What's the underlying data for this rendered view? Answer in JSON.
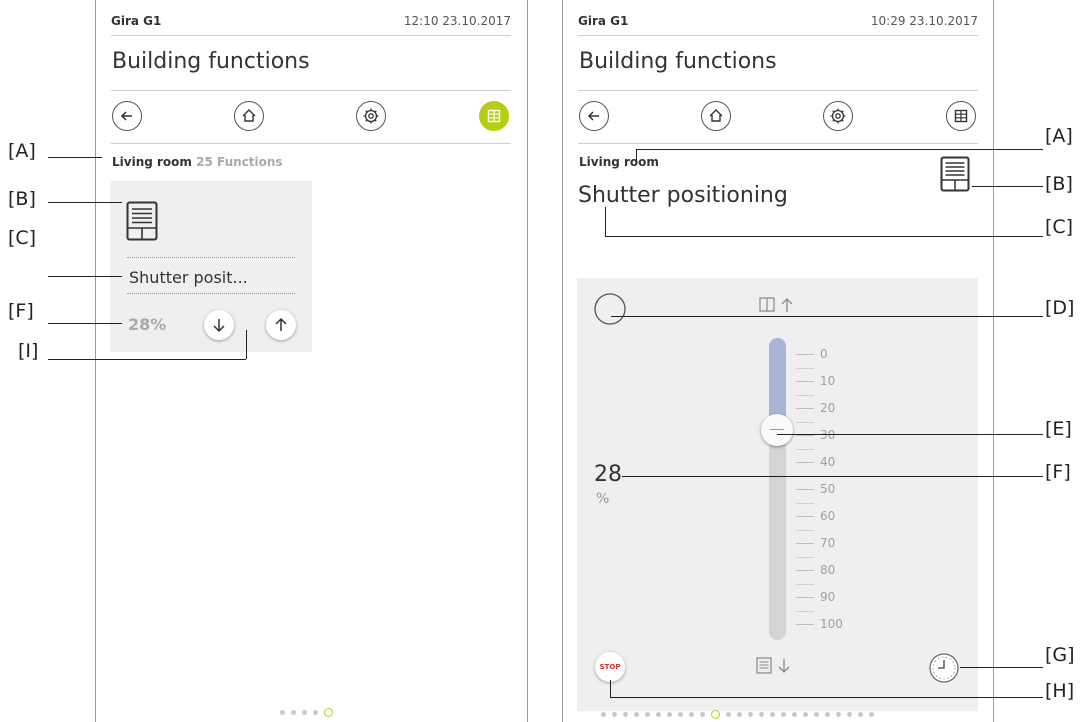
{
  "left": {
    "device": "Gira G1",
    "clock": "12:10  23.10.2017",
    "title": "Building functions",
    "nav": [
      "back-icon",
      "home-icon",
      "settings-icon",
      "grid-icon"
    ],
    "breadcrumb": {
      "room": "Living room",
      "count": "25",
      "suffix": "Functions"
    },
    "tile": {
      "label": "Shutter posit...",
      "value": "28%"
    },
    "pager": {
      "total": 5,
      "active": 4
    }
  },
  "right": {
    "device": "Gira G1",
    "clock": "10:29  23.10.2017",
    "title": "Building functions",
    "nav": [
      "back-icon",
      "home-icon",
      "settings-icon",
      "grid-icon"
    ],
    "breadcrumb": "Living room",
    "function_title": "Shutter positioning",
    "position": {
      "value": "28",
      "unit": "%",
      "fraction": 0.28
    },
    "scale": [
      "0",
      "10",
      "20",
      "30",
      "40",
      "50",
      "60",
      "70",
      "80",
      "90",
      "100"
    ],
    "stop_label": "STOP",
    "pager": {
      "total": 25,
      "active": 10
    }
  },
  "annotations": {
    "left": [
      "[A]",
      "[B]",
      "[C]",
      "[F]",
      "[I]"
    ],
    "right": [
      "[A]",
      "[B]",
      "[C]",
      "[D]",
      "[E]",
      "[F]",
      "[G]",
      "[H]"
    ]
  },
  "colors": {
    "accent": "#b7cd14",
    "slider_fill": "#aab4d6",
    "stop": "#d9302c"
  }
}
